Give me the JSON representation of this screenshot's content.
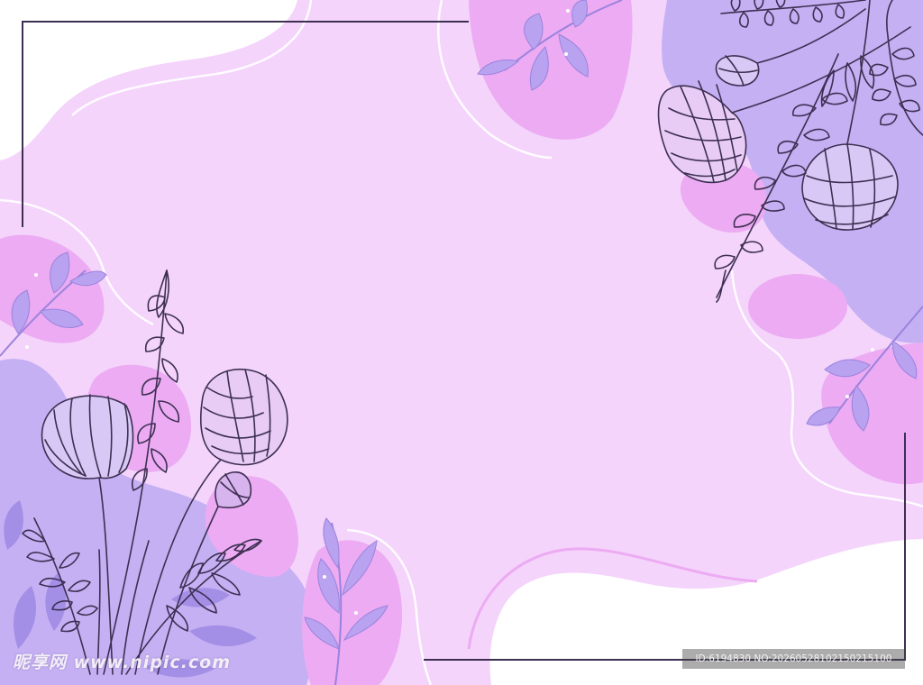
{
  "watermark": {
    "site_logo": "昵享网 www.nipic.com",
    "image_id": "ID:6194830 NO:20260528102150215100"
  },
  "colors": {
    "background": "#f4d4fb",
    "lavender": "#c4b0f3",
    "pink": "#ecabf2",
    "leaf": "#a48fe6",
    "line": "#3d2f52",
    "white": "#ffffff"
  },
  "icons": [
    "flower-bloom-icon",
    "flower-bud-icon",
    "fern-sprig-icon",
    "leaf-branch-icon"
  ]
}
